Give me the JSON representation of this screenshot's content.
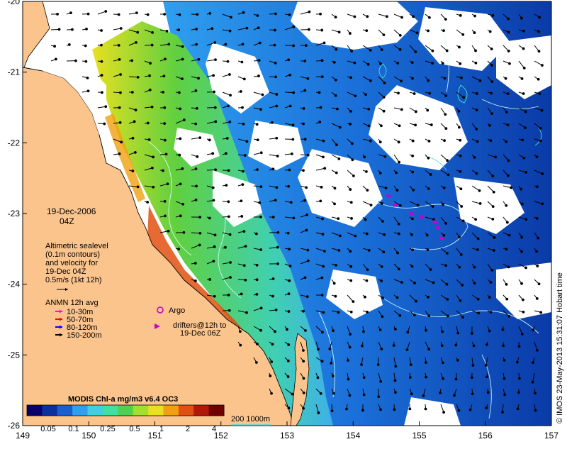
{
  "date": "19-Dec-2006",
  "time": "04Z",
  "altimetry": {
    "lines": [
      "Altimetric sealevel",
      "(0.1m contours)",
      "and velocity for",
      "19-Dec 04Z",
      "0.5m/s (1kt 12h)"
    ]
  },
  "anmn": {
    "title": "ANMN 12h avg",
    "items": [
      {
        "label": "10-30m",
        "color": "#ff00ff"
      },
      {
        "label": "50-70m",
        "color": "#ff0000"
      },
      {
        "label": "80-120m",
        "color": "#0000ff"
      },
      {
        "label": "150-200m",
        "color": "#000000"
      }
    ]
  },
  "argo": {
    "label": "Argo",
    "color": "#cc00cc"
  },
  "drifters": {
    "lines": [
      "drifters@12h to",
      "19-Dec 06Z"
    ],
    "color": "#cc00cc"
  },
  "colorbar": {
    "title": "MODIS Chl-a mg/m3 v6.4 OC3",
    "ticks": [
      "0.05",
      "0.1",
      "0.25",
      "0.5",
      "1",
      "2",
      "4"
    ],
    "colors": [
      "#08006b",
      "#0a2fa0",
      "#1a5fd0",
      "#2f9ff0",
      "#3fd0e0",
      "#40e0a0",
      "#50d050",
      "#a0e030",
      "#e8e020",
      "#f0a010",
      "#e05010",
      "#b01808",
      "#700000"
    ]
  },
  "bathy": {
    "label": "200  1000m",
    "color": "#40e0d0"
  },
  "credit": "© IMOS 23-May-2013 15:31:07 Hobart time",
  "axes": {
    "x_ticks": [
      "149",
      "150",
      "151",
      "152",
      "153",
      "154",
      "155",
      "156",
      "157"
    ],
    "y_ticks": [
      "-20",
      "-21",
      "-22",
      "-23",
      "-24",
      "-25",
      "-26"
    ],
    "lon_range": [
      149,
      157
    ],
    "lat_range": [
      -26,
      -20
    ]
  },
  "colors": {
    "land": "#fbc48d",
    "coast": "#000000"
  },
  "drifter_points": [
    {
      "lon": 154.55,
      "lat": -22.75
    },
    {
      "lon": 154.65,
      "lat": -22.88
    },
    {
      "lon": 154.9,
      "lat": -23.0
    },
    {
      "lon": 155.05,
      "lat": -23.05
    },
    {
      "lon": 155.25,
      "lat": -23.12
    },
    {
      "lon": 155.3,
      "lat": -23.2
    },
    {
      "lon": 155.35,
      "lat": -23.35
    }
  ]
}
